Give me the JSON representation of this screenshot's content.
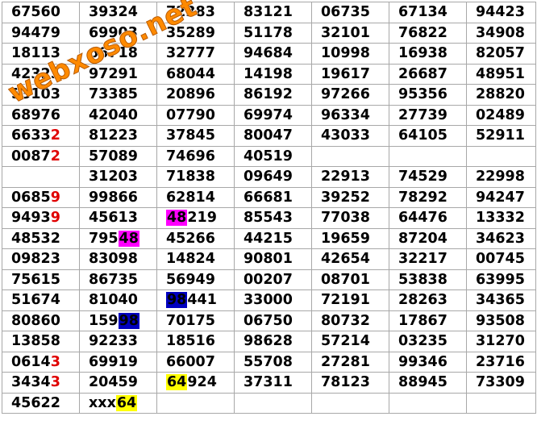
{
  "watermark": "webxoso.net",
  "rows": [
    [
      [
        {
          "t": "67560"
        }
      ],
      [
        {
          "t": "39324"
        }
      ],
      [
        {
          "t": "72383"
        }
      ],
      [
        {
          "t": "83121"
        }
      ],
      [
        {
          "t": "06735"
        }
      ],
      [
        {
          "t": "67134"
        }
      ],
      [
        {
          "t": "94423"
        }
      ]
    ],
    [
      [
        {
          "t": "94479"
        }
      ],
      [
        {
          "t": "69903"
        }
      ],
      [
        {
          "t": "35289"
        }
      ],
      [
        {
          "t": "51178"
        }
      ],
      [
        {
          "t": "32101"
        }
      ],
      [
        {
          "t": "76822"
        }
      ],
      [
        {
          "t": "34908"
        }
      ]
    ],
    [
      [
        {
          "t": "18113"
        }
      ],
      [
        {
          "t": "66718"
        }
      ],
      [
        {
          "t": "32777"
        }
      ],
      [
        {
          "t": "94684"
        }
      ],
      [
        {
          "t": "10998"
        }
      ],
      [
        {
          "t": "16938"
        }
      ],
      [
        {
          "t": "82057"
        }
      ]
    ],
    [
      [
        {
          "t": "42325"
        }
      ],
      [
        {
          "t": "97291"
        }
      ],
      [
        {
          "t": "68044"
        }
      ],
      [
        {
          "t": "14198"
        }
      ],
      [
        {
          "t": "19617"
        }
      ],
      [
        {
          "t": "26687"
        }
      ],
      [
        {
          "t": "48951"
        }
      ]
    ],
    [
      [
        {
          "t": "53103"
        }
      ],
      [
        {
          "t": "73385"
        }
      ],
      [
        {
          "t": "20896"
        }
      ],
      [
        {
          "t": "86192"
        }
      ],
      [
        {
          "t": "97266"
        }
      ],
      [
        {
          "t": "95356"
        }
      ],
      [
        {
          "t": "28820"
        }
      ]
    ],
    [
      [
        {
          "t": "68976"
        }
      ],
      [
        {
          "t": "42040"
        }
      ],
      [
        {
          "t": "07790"
        }
      ],
      [
        {
          "t": "69974"
        }
      ],
      [
        {
          "t": "96334"
        }
      ],
      [
        {
          "t": "27739"
        }
      ],
      [
        {
          "t": "02489"
        }
      ]
    ],
    [
      [
        {
          "t": "6633"
        },
        {
          "t": "2",
          "s": "red"
        }
      ],
      [
        {
          "t": "81223"
        }
      ],
      [
        {
          "t": "37845"
        }
      ],
      [
        {
          "t": "80047"
        }
      ],
      [
        {
          "t": "43033"
        }
      ],
      [
        {
          "t": "64105"
        }
      ],
      [
        {
          "t": "52911"
        }
      ]
    ],
    [
      [
        {
          "t": "0087"
        },
        {
          "t": "2",
          "s": "red"
        }
      ],
      [
        {
          "t": "57089"
        }
      ],
      [
        {
          "t": "74696"
        }
      ],
      [
        {
          "t": "40519"
        }
      ],
      [],
      [],
      []
    ],
    [
      [],
      [
        {
          "t": "31203"
        }
      ],
      [
        {
          "t": "71838"
        }
      ],
      [
        {
          "t": "09649"
        }
      ],
      [
        {
          "t": "22913"
        }
      ],
      [
        {
          "t": "74529"
        }
      ],
      [
        {
          "t": "22998"
        }
      ]
    ],
    [
      [
        {
          "t": "0685"
        },
        {
          "t": "9",
          "s": "red"
        }
      ],
      [
        {
          "t": "99866"
        }
      ],
      [
        {
          "t": "62814"
        }
      ],
      [
        {
          "t": "66681"
        }
      ],
      [
        {
          "t": "39252"
        }
      ],
      [
        {
          "t": "78292"
        }
      ],
      [
        {
          "t": "94247"
        }
      ]
    ],
    [
      [
        {
          "t": "9493"
        },
        {
          "t": "9",
          "s": "red"
        }
      ],
      [
        {
          "t": "45613"
        }
      ],
      [
        {
          "t": "48",
          "s": "magenta"
        },
        {
          "t": "219"
        }
      ],
      [
        {
          "t": "85543"
        }
      ],
      [
        {
          "t": "77038"
        }
      ],
      [
        {
          "t": "64476"
        }
      ],
      [
        {
          "t": "13332"
        }
      ]
    ],
    [
      [
        {
          "t": "48532"
        }
      ],
      [
        {
          "t": "795"
        },
        {
          "t": "48",
          "s": "magenta"
        }
      ],
      [
        {
          "t": "45266"
        }
      ],
      [
        {
          "t": "44215"
        }
      ],
      [
        {
          "t": "19659"
        }
      ],
      [
        {
          "t": "87204"
        }
      ],
      [
        {
          "t": "34623"
        }
      ]
    ],
    [
      [
        {
          "t": "09823"
        }
      ],
      [
        {
          "t": "83098"
        }
      ],
      [
        {
          "t": "14824"
        }
      ],
      [
        {
          "t": "90801"
        }
      ],
      [
        {
          "t": "42654"
        }
      ],
      [
        {
          "t": "32217"
        }
      ],
      [
        {
          "t": "00745"
        }
      ]
    ],
    [
      [
        {
          "t": "75615"
        }
      ],
      [
        {
          "t": "86735"
        }
      ],
      [
        {
          "t": "56949"
        }
      ],
      [
        {
          "t": "00207"
        }
      ],
      [
        {
          "t": "08701"
        }
      ],
      [
        {
          "t": "53838"
        }
      ],
      [
        {
          "t": "63995"
        }
      ]
    ],
    [
      [
        {
          "t": "51674"
        }
      ],
      [
        {
          "t": "81040"
        }
      ],
      [
        {
          "t": "98",
          "s": "blue"
        },
        {
          "t": "441"
        }
      ],
      [
        {
          "t": "33000"
        }
      ],
      [
        {
          "t": "72191"
        }
      ],
      [
        {
          "t": "28263"
        }
      ],
      [
        {
          "t": "34365"
        }
      ]
    ],
    [
      [
        {
          "t": "80860"
        }
      ],
      [
        {
          "t": "159"
        },
        {
          "t": "98",
          "s": "blue"
        }
      ],
      [
        {
          "t": "70175"
        }
      ],
      [
        {
          "t": "06750"
        }
      ],
      [
        {
          "t": "80732"
        }
      ],
      [
        {
          "t": "17867"
        }
      ],
      [
        {
          "t": "93508"
        }
      ]
    ],
    [
      [
        {
          "t": "13858"
        }
      ],
      [
        {
          "t": "92233"
        }
      ],
      [
        {
          "t": "18516"
        }
      ],
      [
        {
          "t": "98628"
        }
      ],
      [
        {
          "t": "57214"
        }
      ],
      [
        {
          "t": "03235"
        }
      ],
      [
        {
          "t": "31270"
        }
      ]
    ],
    [
      [
        {
          "t": "0614"
        },
        {
          "t": "3",
          "s": "red"
        }
      ],
      [
        {
          "t": "69919"
        }
      ],
      [
        {
          "t": "66007"
        }
      ],
      [
        {
          "t": "55708"
        }
      ],
      [
        {
          "t": "27281"
        }
      ],
      [
        {
          "t": "99346"
        }
      ],
      [
        {
          "t": "23716"
        }
      ]
    ],
    [
      [
        {
          "t": "3434"
        },
        {
          "t": "3",
          "s": "red"
        }
      ],
      [
        {
          "t": "20459"
        }
      ],
      [
        {
          "t": "64",
          "s": "yellow"
        },
        {
          "t": "924"
        }
      ],
      [
        {
          "t": "37311"
        }
      ],
      [
        {
          "t": "78123"
        }
      ],
      [
        {
          "t": "88945"
        }
      ],
      [
        {
          "t": "73309"
        }
      ]
    ],
    [
      [
        {
          "t": "45622"
        }
      ],
      [
        {
          "t": "xxx"
        },
        {
          "t": "64",
          "s": "yellow"
        }
      ],
      [],
      [],
      [],
      [],
      []
    ]
  ]
}
